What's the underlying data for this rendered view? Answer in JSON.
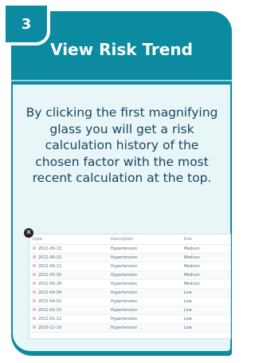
{
  "step": "3",
  "title": "View Risk Trend",
  "description": "By clicking the first magnifying glass you will get a risk calculation history of the chosen factor with the most recent calculation at the top.",
  "table": {
    "headers": [
      "Date",
      "Description",
      "Risk"
    ],
    "rows": [
      {
        "date": "2021-09-13",
        "description": "Hypertension",
        "risk": "Medium"
      },
      {
        "date": "2021-06-15",
        "description": "Hypertension",
        "risk": "Medium"
      },
      {
        "date": "2021-06-11",
        "description": "Hypertension",
        "risk": "Medium"
      },
      {
        "date": "2021-05-30",
        "description": "Hypertension",
        "risk": "Medium"
      },
      {
        "date": "2021-05-28",
        "description": "Hypertension",
        "risk": "Medium"
      },
      {
        "date": "2021-04-04",
        "description": "Hypertension",
        "risk": "Low"
      },
      {
        "date": "2021-04-01",
        "description": "Hypertension",
        "risk": "Low"
      },
      {
        "date": "2021-02-15",
        "description": "Hypertension",
        "risk": "Low"
      },
      {
        "date": "2021-01-12",
        "description": "Hypertension",
        "risk": "Low"
      },
      {
        "date": "2020-11-19",
        "description": "Hypertension",
        "risk": "Low"
      }
    ]
  },
  "colors": {
    "accent": "#0c8aa0",
    "panel": "#e8f6f8",
    "text": "#15475e"
  }
}
